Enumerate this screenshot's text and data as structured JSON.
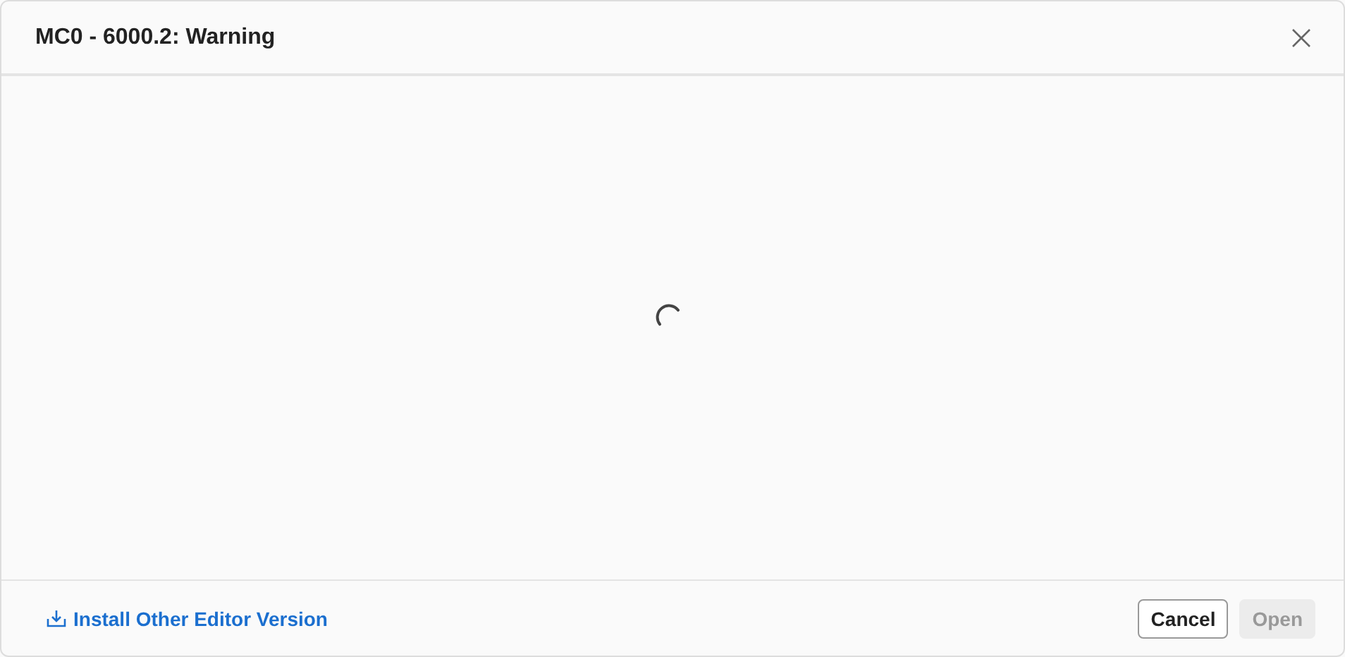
{
  "dialog": {
    "title": "MC0 - 6000.2: Warning",
    "loading": true
  },
  "footer": {
    "link": "Install Other Editor Version",
    "buttons": [
      {
        "label": "Cancel",
        "disabled": false
      },
      {
        "label": "Open",
        "disabled": true
      }
    ]
  }
}
